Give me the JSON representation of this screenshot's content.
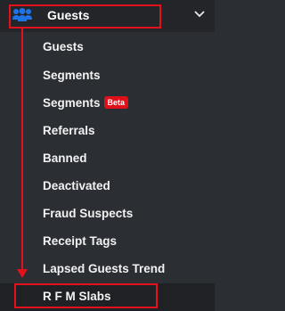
{
  "header": {
    "label": "Guests",
    "icon": "users-icon",
    "expand_icon": "chevron-down-icon"
  },
  "submenu": {
    "items": [
      {
        "label": "Guests"
      },
      {
        "label": "Segments"
      },
      {
        "label": "Segments",
        "badge": "Beta"
      },
      {
        "label": "Referrals"
      },
      {
        "label": "Banned"
      },
      {
        "label": "Deactivated"
      },
      {
        "label": "Fraud Suspects"
      },
      {
        "label": "Receipt Tags"
      },
      {
        "label": "Lapsed Guests Trend"
      },
      {
        "label": "R F M Slabs"
      }
    ]
  },
  "colors": {
    "annotation": "#e3111b",
    "icon_blue": "#1e73e6",
    "badge": "#e0101a"
  }
}
